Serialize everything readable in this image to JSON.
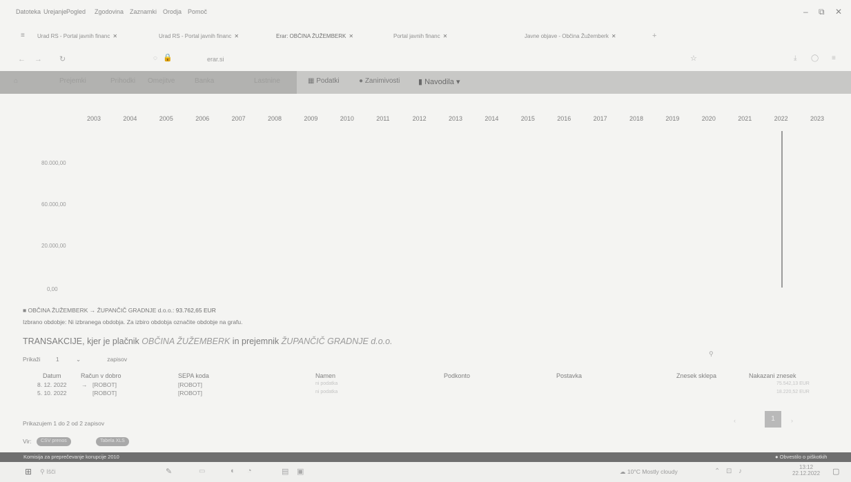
{
  "browser": {
    "menu": [
      "Datoteka",
      "Urejanje",
      "Pogled",
      "Zgodovina",
      "Zaznamki",
      "Orodja",
      "Pomoč"
    ],
    "window_controls": [
      "–",
      "⧉",
      "✕"
    ],
    "tabs": [
      "Urad RS - Portal javnih financ",
      "Urad RS - Portal javnih financ",
      "Erar: OBČINA ŽUŽEMBERK",
      "Portal javnih financ",
      "Javne objave - Občina Žužemberk"
    ],
    "address": "erar.si"
  },
  "site_nav": {
    "items_dim": [
      "Prejemki",
      "Prihodki",
      "Omejitve",
      "Banka",
      "Lastnine"
    ],
    "items": [
      "Podatki",
      "Zanimivosti",
      "Navodila"
    ]
  },
  "chart_data": {
    "type": "bar",
    "categories": [
      "2003",
      "2004",
      "2005",
      "2006",
      "2007",
      "2008",
      "2009",
      "2010",
      "2011",
      "2012",
      "2013",
      "2014",
      "2015",
      "2016",
      "2017",
      "2018",
      "2019",
      "2020",
      "2021",
      "2022",
      "2023"
    ],
    "values": [
      0,
      0,
      0,
      0,
      0,
      0,
      0,
      0,
      0,
      0,
      0,
      0,
      0,
      0,
      0,
      0,
      0,
      0,
      0,
      93762.65,
      0
    ],
    "yticks": [
      "80.000,00",
      "60.000,00",
      "20.000,00",
      "0,00"
    ],
    "ylim": [
      0,
      100000
    ]
  },
  "legend": {
    "label": "OBČINA ŽUŽEMBERK → ŽUPANČIČ GRADNJE d.o.o.:",
    "amount": "93.762,65 EUR",
    "note": "Izbrano obdobje: Ni izbranega obdobja. Za izbiro obdobja označite obdobje na grafu."
  },
  "transactions": {
    "title_prefix": "TRANSAKCIJE, kjer je plačnik ",
    "payer": "OBČINA ŽUŽEMBERK",
    "middle": " in prejemnik ",
    "recipient": "ŽUPANČIČ GRADNJE d.o.o.",
    "show_label": "Prikaži",
    "show_value": "1",
    "show_suffix": "zapisov",
    "columns": [
      "Datum",
      "Račun v dobro",
      "SEPA koda",
      "Namen",
      "Podkonto",
      "Postavka",
      "Znesek sklepa",
      "Nakazani znesek"
    ],
    "rows": [
      {
        "date": "8. 12. 2022",
        "account": "[ROBOT]",
        "sepa": "[ROBOT]",
        "purpose": "ni podatka",
        "amount": "75.542,13 EUR"
      },
      {
        "date": "5. 10. 2022",
        "account": "[ROBOT]",
        "sepa": "[ROBOT]",
        "purpose": "ni podatka",
        "amount": "18.220,52 EUR"
      }
    ],
    "summary": "Prikazujem 1 do 2 od 2 zapisov",
    "page": "1",
    "share_label": "Vir:",
    "share_buttons": [
      "CSV prenos",
      "Tabela XLS"
    ]
  },
  "status_strip": {
    "left": "Komisija za preprečevanje korupcije 2010",
    "right": "Obvestilo o piškotkih"
  },
  "taskbar": {
    "search": "Išči",
    "weather": "10°C  Mostly cloudy",
    "time": "13:12",
    "date": "22.12.2022"
  }
}
